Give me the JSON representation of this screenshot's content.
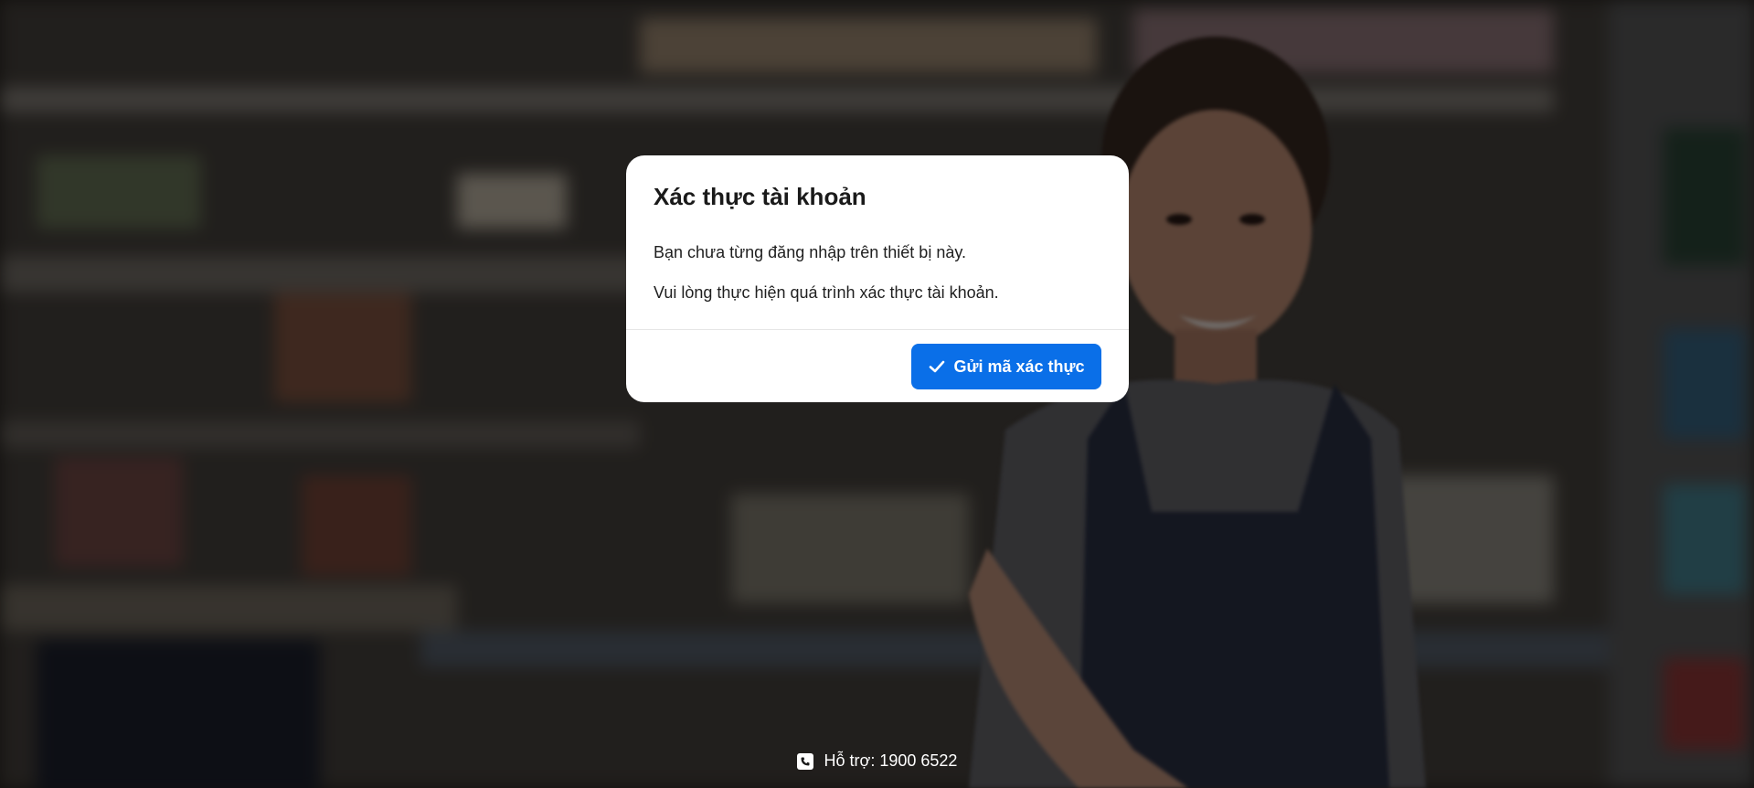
{
  "modal": {
    "title": "Xác thực tài khoản",
    "line1": "Bạn chưa từng đăng nhập trên thiết bị này.",
    "line2": "Vui lòng thực hiện quá trình xác thực tài khoản.",
    "button_label": "Gửi mã xác thực",
    "button_icon": "check-icon"
  },
  "footer": {
    "support_label": "Hỗ trợ: 1900 6522",
    "support_icon": "phone-icon"
  },
  "colors": {
    "accent": "#0a6fe8",
    "overlay": "rgba(0,0,0,0.55)"
  }
}
